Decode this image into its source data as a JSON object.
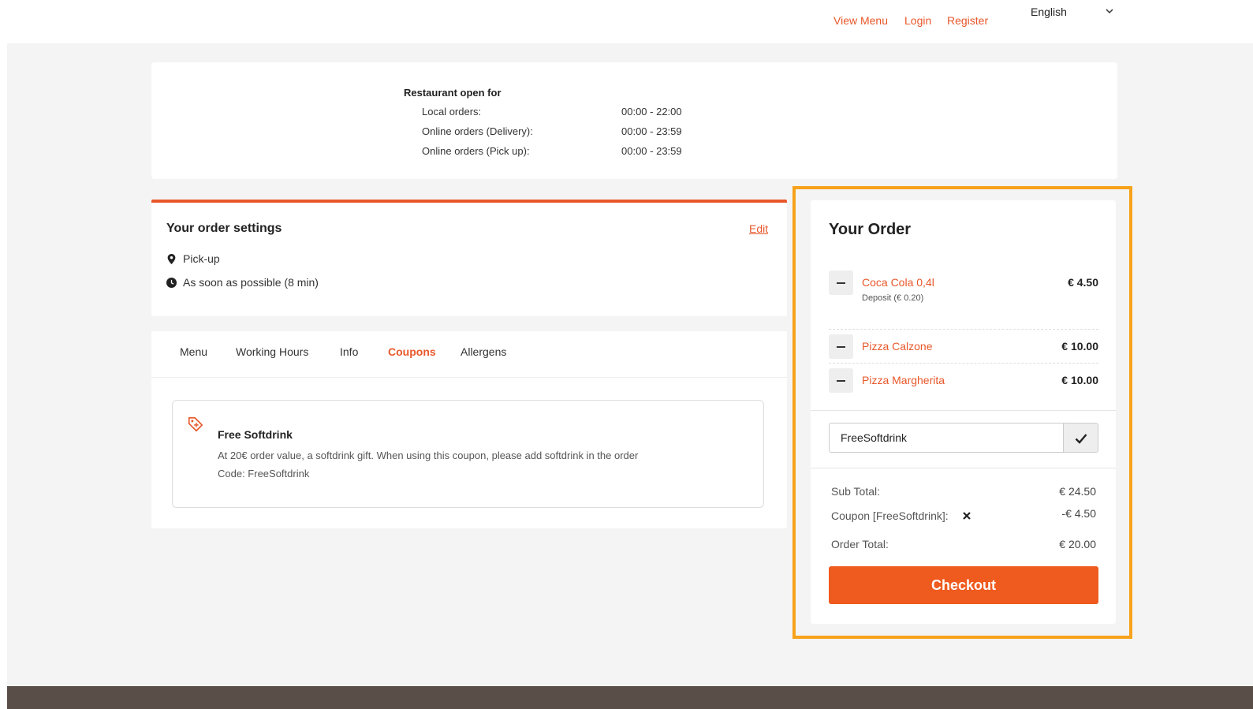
{
  "header": {
    "nav": [
      "View Menu",
      "Login",
      "Register"
    ],
    "language": "English"
  },
  "hours": {
    "title": "Restaurant open for",
    "rows": [
      {
        "label": "Local orders:",
        "value": "00:00 - 22:00"
      },
      {
        "label": "Online orders (Delivery):",
        "value": "00:00 - 23:59"
      },
      {
        "label": "Online orders (Pick up):",
        "value": "00:00 - 23:59"
      }
    ]
  },
  "settings": {
    "title": "Your order settings",
    "edit": "Edit",
    "mode": "Pick-up",
    "time": "As soon as possible (8 min)"
  },
  "tabs": [
    "Menu",
    "Working Hours",
    "Info",
    "Coupons",
    "Allergens"
  ],
  "active_tab": "Coupons",
  "coupon": {
    "title": "Free Softdrink",
    "description": "At 20€ order value, a softdrink gift. When using this coupon, please add softdrink in the order",
    "code": "Code: FreeSoftdrink"
  },
  "order": {
    "title": "Your Order",
    "items": [
      {
        "name": "Coca Cola 0,4l",
        "price": "€ 4.50",
        "note": "Deposit (€ 0.20)"
      },
      {
        "name": "Pizza Calzone",
        "price": "€ 10.00"
      },
      {
        "name": "Pizza Margherita",
        "price": "€ 10.00"
      }
    ],
    "coupon_input": "FreeSoftdrink",
    "subtotal_label": "Sub Total:",
    "subtotal": "€ 24.50",
    "coupon_label": "Coupon [FreeSoftdrink]:",
    "coupon_value": "-€ 4.50",
    "total_label": "Order Total:",
    "total": "€ 20.00",
    "checkout": "Checkout"
  },
  "colors": {
    "accent": "#e8572a",
    "checkout": "#ef5a1e",
    "highlight": "#f7a21b",
    "footer": "#5a4e48"
  }
}
